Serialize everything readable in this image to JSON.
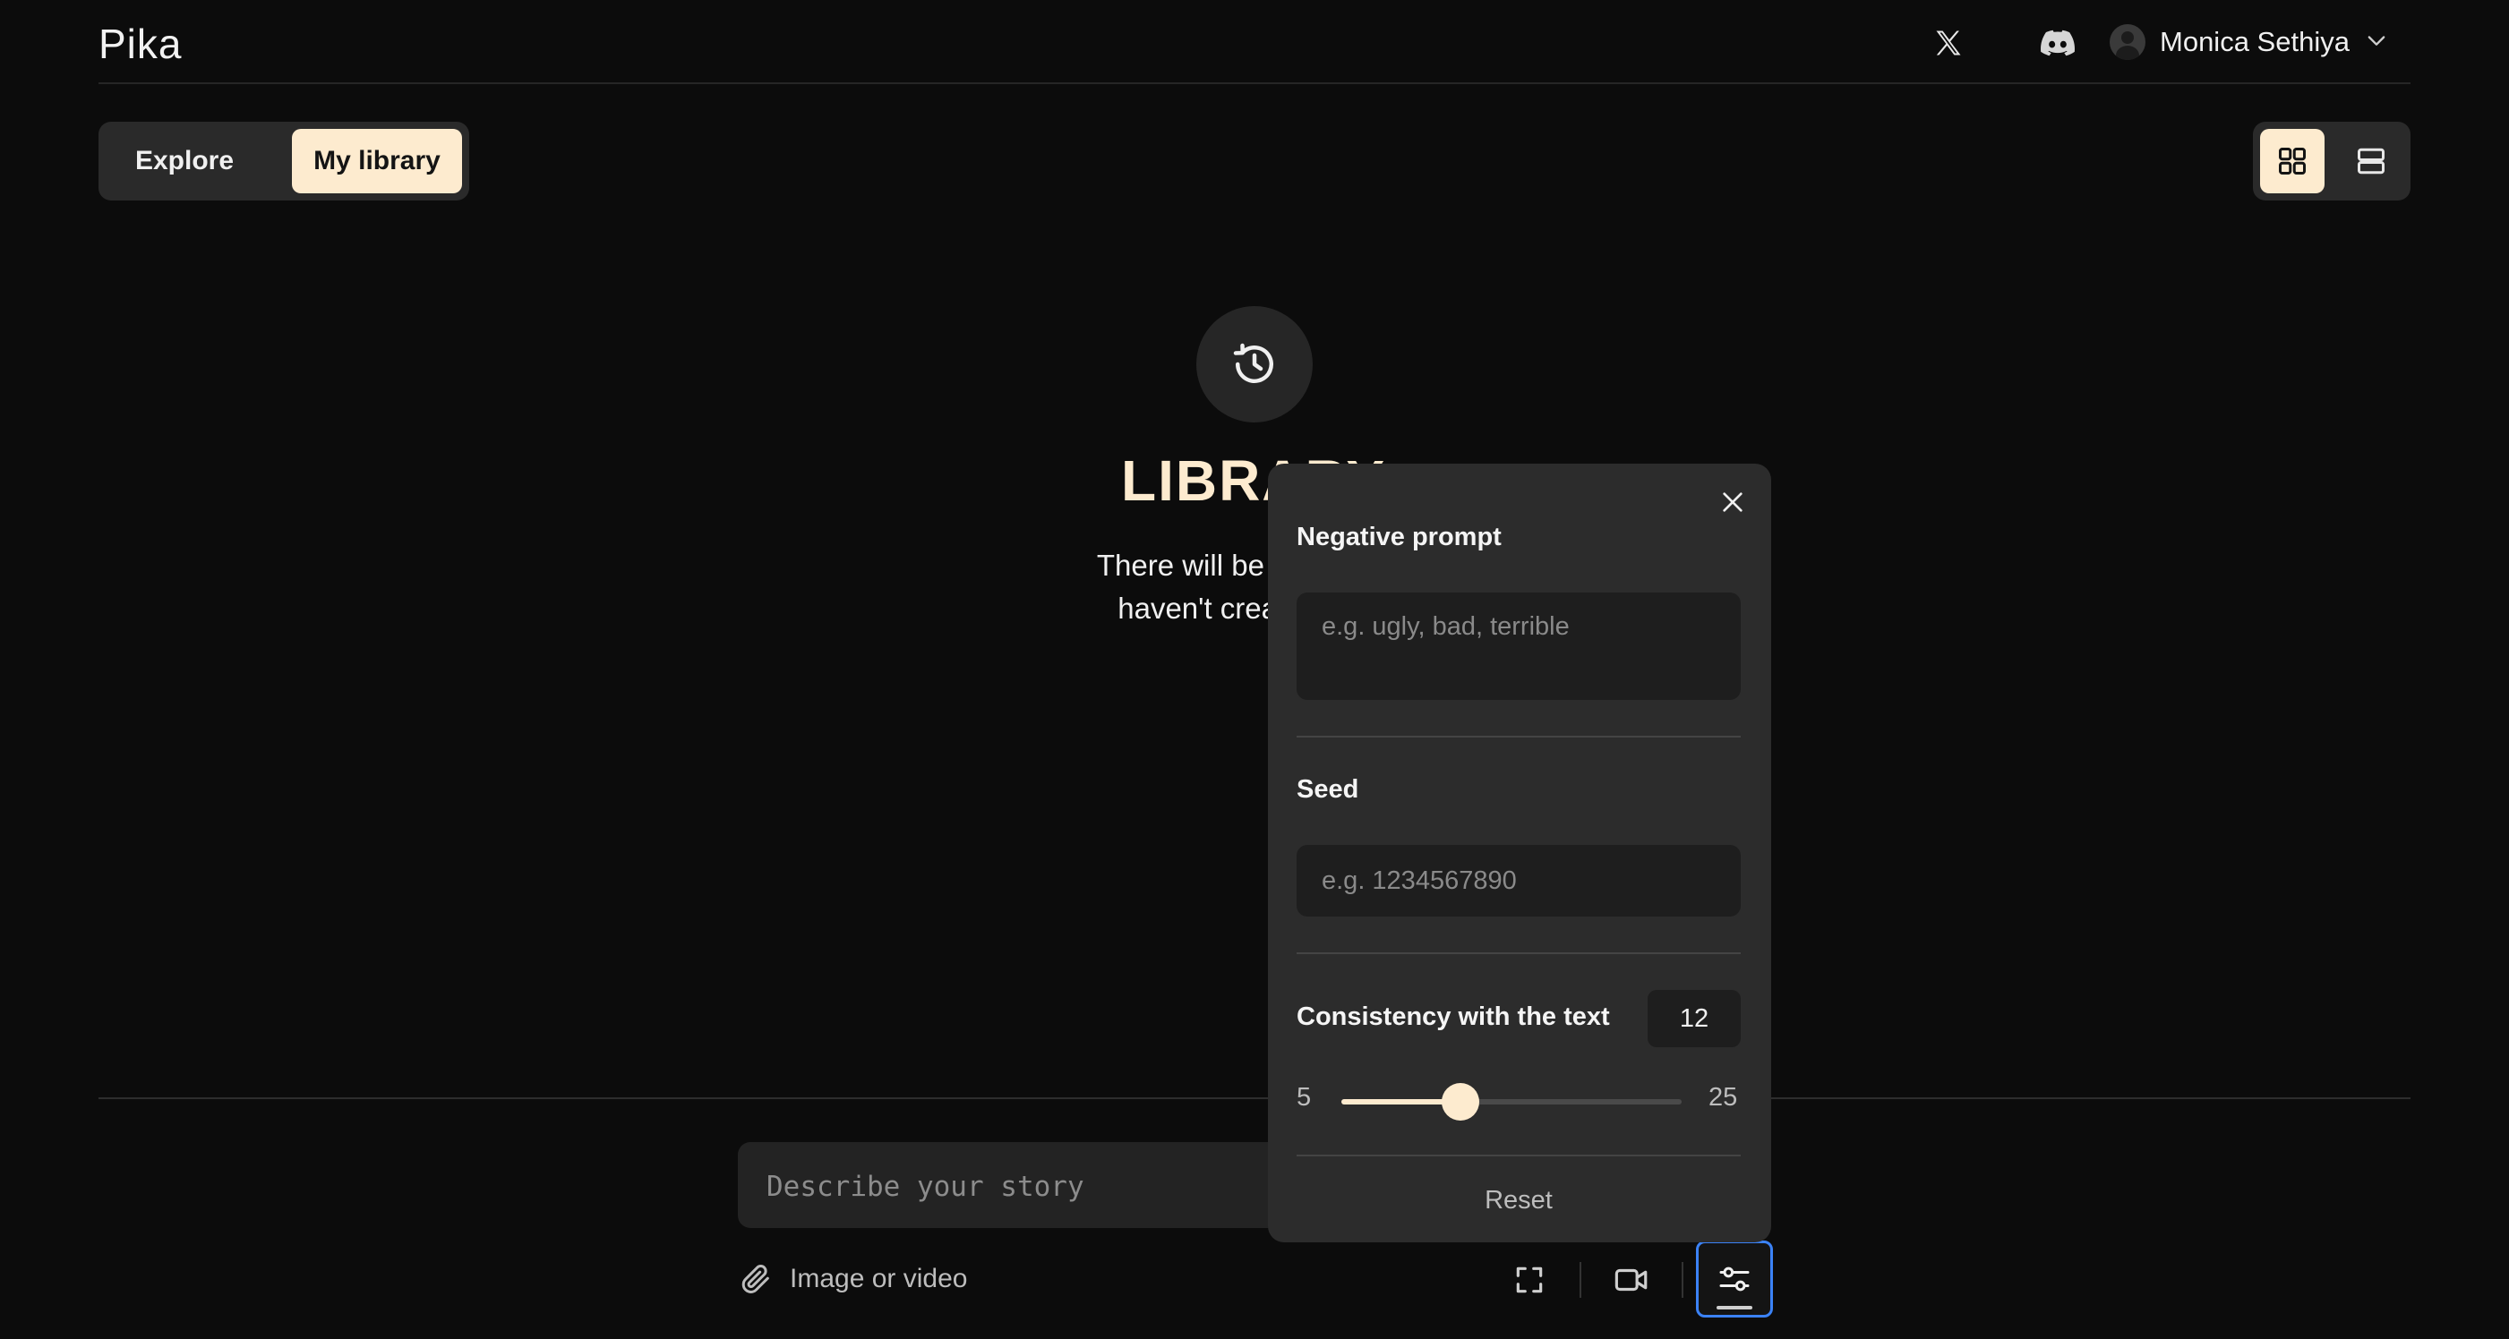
{
  "header": {
    "logo": "Pika",
    "user_name": "Monica Sethiya"
  },
  "tabs": {
    "explore": "Explore",
    "my_library": "My library",
    "active": "my_library"
  },
  "empty_state": {
    "title": "LIBRARY",
    "text_line1": "There will be a library of",
    "text_line2": "haven't created a vid"
  },
  "prompt": {
    "placeholder": "Describe your story",
    "attach_label": "Image or video"
  },
  "settings_popover": {
    "negative_prompt_label": "Negative prompt",
    "negative_prompt_placeholder": "e.g. ugly, bad, terrible",
    "seed_label": "Seed",
    "seed_placeholder": "e.g. 1234567890",
    "consistency_label": "Consistency with the text",
    "consistency_value": "12",
    "slider_min": "5",
    "slider_max": "25",
    "reset_label": "Reset"
  },
  "colors": {
    "accent": "#fdebcf",
    "background": "#0c0c0c",
    "panel": "#2c2c2c",
    "focus": "#3b82f6"
  }
}
